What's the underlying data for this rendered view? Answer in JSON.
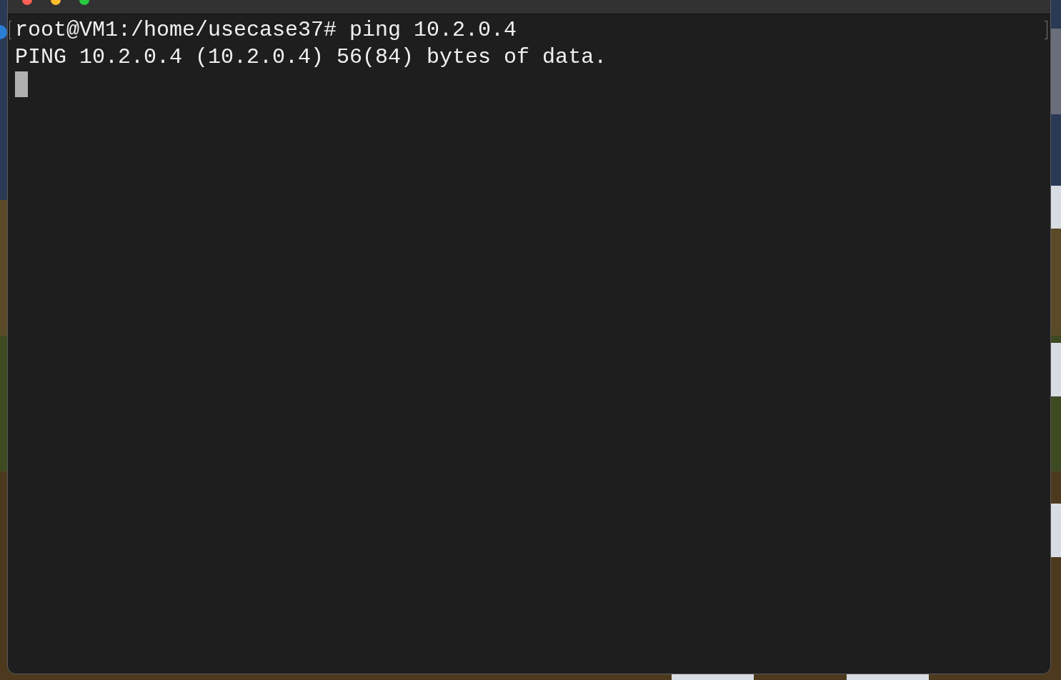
{
  "terminal": {
    "lines": [
      {
        "text": "root@VM1:/home/usecase37# ping 10.2.0.4",
        "marked": true
      },
      {
        "text": "PING 10.2.0.4 (10.2.0.4) 56(84) bytes of data.",
        "marked": false
      }
    ],
    "cursor": true
  }
}
